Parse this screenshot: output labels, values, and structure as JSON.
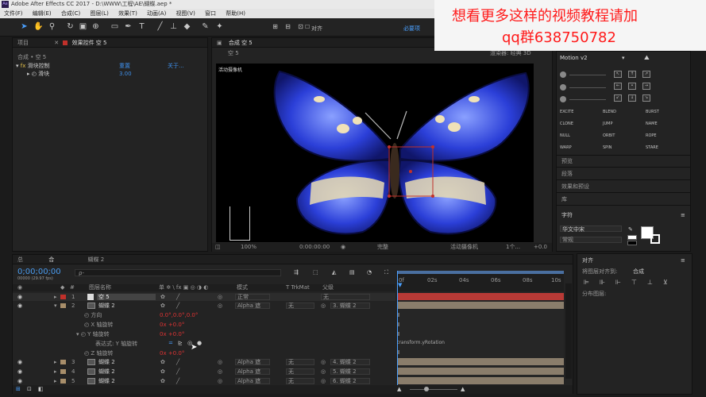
{
  "titlebar": {
    "title": "Adobe After Effects CC 2017 - D:\\WWW\\工程\\AE\\蝴蝶.aep *"
  },
  "menu": [
    "文件(F)",
    "编辑(E)",
    "合成(C)",
    "图层(L)",
    "效果(T)",
    "动画(A)",
    "视图(V)",
    "窗口",
    "帮助(H)"
  ],
  "toolbar": {
    "snap_label": "对齐",
    "workspace_label": "必要项"
  },
  "overlay": {
    "line1": "想看更多这样的视频教程请加",
    "line2": "qq群638750782"
  },
  "project_panel": {
    "tab": "项目",
    "effects_tab": "效果控件 空 5",
    "breadcrumb": "合成 • 空 5",
    "effect_name": "滑块控制",
    "effect_reset": "重置",
    "effect_about": "关于...",
    "slider_label": "滑块",
    "slider_value": "3.00"
  },
  "comp_viewer": {
    "tab": "合成 空 5",
    "sub_tab": "空 5",
    "renderer": "渲染器: 经典 3D",
    "corner_label": "活动摄像机",
    "zoom": "100%",
    "timecode": "0:00:00:00",
    "resolution": "完整",
    "camera": "活动摄像机",
    "views": "1个...",
    "offset": "+0.0"
  },
  "motion_panel": {
    "title": "Motion v2",
    "buttons": [
      "EXCITE",
      "BLEND",
      "BURST",
      "CLONE",
      "JUMP",
      "NAME",
      "NULL",
      "ORBIT",
      "ROPE",
      "WARP",
      "SPIN",
      "STARE"
    ],
    "sections": [
      "预览",
      "段落",
      "效果和预设",
      "库",
      "字符"
    ],
    "font_name": "华文中宋",
    "font_style": "常规",
    "align_title": "对齐",
    "align_to_label": "将图层对齐到:",
    "align_to_value": "合成",
    "distribute_label": "分布图层:"
  },
  "timeline": {
    "tabs": [
      "总",
      "合",
      "蝴蝶 2"
    ],
    "timecode": "0;00;00;00",
    "fps": "00000 (29.97 fps)",
    "search_placeholder": "ρ-",
    "columns": {
      "num": "#",
      "name": "图层名称",
      "switches": "单 ✲ \\ fx ▣ ◎ ◑ ◐",
      "mode": "模式",
      "trkmat": "T TrkMat",
      "parent": "父级"
    },
    "ruler_ticks": [
      "0f",
      "02s",
      "04s",
      "06s",
      "08s",
      "10s"
    ],
    "layers": [
      {
        "num": "1",
        "name": "空 5",
        "mode": "正常",
        "trkmat": "",
        "parent": "无",
        "color": "#c0302a",
        "expanded": false
      },
      {
        "num": "2",
        "name": "蝴蝶 2",
        "mode": "Alpha 遮",
        "trkmat": "无",
        "parent": "3. 蝴蝶 2",
        "color": "#a88e6a",
        "expanded": true
      }
    ],
    "props": [
      {
        "name": "方向",
        "value": "0.0°,0.0°,0.0°"
      },
      {
        "name": "X 轴旋转",
        "value": "0x +0.0°"
      },
      {
        "name": "Y 轴旋转",
        "value": "0x +0.0°"
      },
      {
        "name": "表达式: Y 轴旋转",
        "value": ""
      },
      {
        "name": "Z 轴旋转",
        "value": "0x +0.0°"
      }
    ],
    "expression_text": "transform.yRotation",
    "lower_layers": [
      {
        "num": "3",
        "name": "蝴蝶 2",
        "mode": "Alpha 遮",
        "trkmat": "无",
        "parent": "4. 蝴蝶 2"
      },
      {
        "num": "4",
        "name": "蝴蝶 2",
        "mode": "Alpha 遮",
        "trkmat": "无",
        "parent": "5. 蝴蝶 2"
      },
      {
        "num": "5",
        "name": "蝴蝶 2",
        "mode": "Alpha 遮",
        "trkmat": "无",
        "parent": "6. 蝴蝶 2"
      }
    ]
  },
  "colors": {
    "accent": "#3e8ee8",
    "wing_blue": "#2b3fd8",
    "null_red": "#c0302a",
    "layer_tan": "#a88e6a"
  }
}
